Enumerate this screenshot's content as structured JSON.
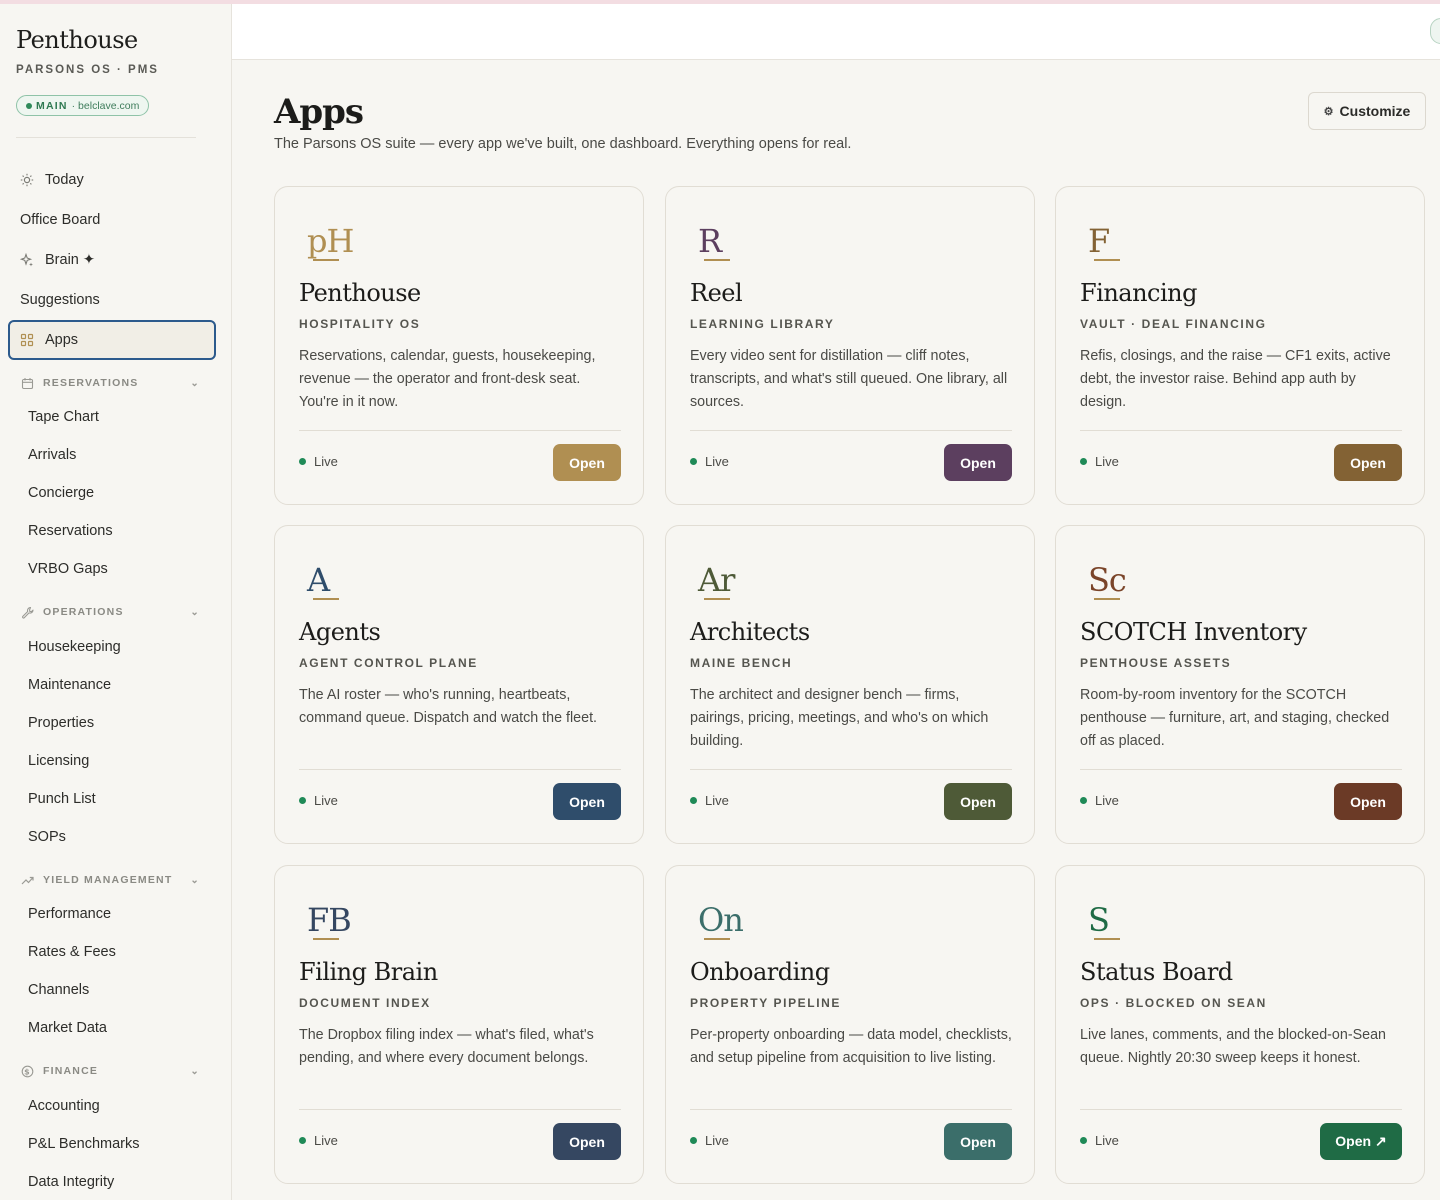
{
  "brand": {
    "name": "Penthouse",
    "subtitle": "PARSONS OS · PMS",
    "env_label": "MAIN",
    "env_domain": "· belclave.com"
  },
  "nav": {
    "top_items": [
      {
        "label": "Today",
        "icon": "sun-icon"
      },
      {
        "label": "Office Board",
        "icon": ""
      },
      {
        "label": "Brain ✦",
        "icon": "sparkle-icon"
      },
      {
        "label": "Suggestions",
        "icon": ""
      },
      {
        "label": "Apps",
        "icon": "grid-icon",
        "active": true
      }
    ],
    "sections": [
      {
        "title": "RESERVATIONS",
        "icon": "calendar-icon",
        "items": [
          "Tape Chart",
          "Arrivals",
          "Concierge",
          "Reservations",
          "VRBO Gaps"
        ]
      },
      {
        "title": "OPERATIONS",
        "icon": "wrench-icon",
        "items": [
          "Housekeeping",
          "Maintenance",
          "Properties",
          "Licensing",
          "Punch List",
          "SOPs"
        ]
      },
      {
        "title": "YIELD MANAGEMENT",
        "icon": "trend-icon",
        "items": [
          "Performance",
          "Rates & Fees",
          "Channels",
          "Market Data"
        ]
      },
      {
        "title": "FINANCE",
        "icon": "dollar-icon",
        "items": [
          "Accounting",
          "P&L Benchmarks",
          "Data Integrity"
        ]
      }
    ]
  },
  "page": {
    "title": "Apps",
    "subtitle": "The Parsons OS suite — every app we've built, one dashboard. Everything opens for real.",
    "customize_label": "Customize"
  },
  "apps": [
    {
      "monogram": "pH",
      "title": "Penthouse",
      "kicker": "HOSPITALITY OS",
      "desc": "Reservations, calendar, guests, housekeeping, revenue — the operator and front-desk seat. You're in it now.",
      "status": "Live",
      "button": "Open",
      "color": "#b08f52",
      "mono_color": "#b08f52",
      "line_color": "#b08f52"
    },
    {
      "monogram": "R",
      "title": "Reel",
      "kicker": "LEARNING LIBRARY",
      "desc": "Every video sent for distillation — cliff notes, transcripts, and what's still queued. One library, all sources.",
      "status": "Live",
      "button": "Open",
      "color": "#5c3f5f",
      "mono_color": "#5c3f5f",
      "line_color": "#b08f52"
    },
    {
      "monogram": "F",
      "title": "Financing",
      "kicker": "VAULT · DEAL FINANCING",
      "desc": "Refis, closings, and the raise — CF1 exits, active debt, the investor raise. Behind app auth by design.",
      "status": "Live",
      "button": "Open",
      "color": "#836234",
      "mono_color": "#836234",
      "line_color": "#b08f52"
    },
    {
      "monogram": "A",
      "title": "Agents",
      "kicker": "AGENT CONTROL PLANE",
      "desc": "The AI roster — who's running, heartbeats, command queue. Dispatch and watch the fleet.",
      "status": "Live",
      "button": "Open",
      "color": "#2f4d6b",
      "mono_color": "#2f4d6b",
      "line_color": "#b08f52"
    },
    {
      "monogram": "Ar",
      "title": "Architects",
      "kicker": "MAINE BENCH",
      "desc": "The architect and designer bench — firms, pairings, pricing, meetings, and who's on which building.",
      "status": "Live",
      "button": "Open",
      "color": "#4e5a37",
      "mono_color": "#4e5a37",
      "line_color": "#b08f52"
    },
    {
      "monogram": "Sc",
      "title": "SCOTCH Inventory",
      "kicker": "PENTHOUSE ASSETS",
      "desc": "Room-by-room inventory for the SCOTCH penthouse — furniture, art, and staging, checked off as placed.",
      "status": "Live",
      "button": "Open",
      "color": "#6b3a26",
      "mono_color": "#7a4429",
      "line_color": "#b08f52"
    },
    {
      "monogram": "FB",
      "title": "Filing Brain",
      "kicker": "DOCUMENT INDEX",
      "desc": "The Dropbox filing index — what's filed, what's pending, and where every document belongs.",
      "status": "Live",
      "button": "Open",
      "color": "#354761",
      "mono_color": "#354761",
      "line_color": "#b08f52"
    },
    {
      "monogram": "On",
      "title": "Onboarding",
      "kicker": "PROPERTY PIPELINE",
      "desc": "Per-property onboarding — data model, checklists, and setup pipeline from acquisition to live listing.",
      "status": "Live",
      "button": "Open",
      "color": "#3b6e6a",
      "mono_color": "#3b6e6a",
      "line_color": "#b08f52"
    },
    {
      "monogram": "S",
      "title": "Status Board",
      "kicker": "OPS · BLOCKED ON SEAN",
      "desc": "Live lanes, comments, and the blocked-on-Sean queue. Nightly 20:30 sweep keeps it honest.",
      "status": "Live",
      "button": "Open ↗",
      "color": "#1f6b45",
      "mono_color": "#1f6b45",
      "line_color": "#b08f52"
    }
  ]
}
